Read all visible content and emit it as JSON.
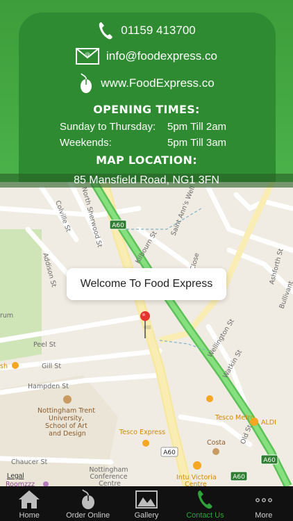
{
  "contact": {
    "phone": "01159 413700",
    "email": "info@foodexpress.co",
    "website": "www.FoodExpress.co"
  },
  "opening_times": {
    "heading": "OPENING TIMES:",
    "rows": [
      {
        "days": "Sunday to Thursday:",
        "hours": "5pm Till  2am"
      },
      {
        "days": "Weekends:",
        "hours": "5pm Till  3am"
      }
    ]
  },
  "map_location": {
    "heading": "MAP LOCATION:",
    "address": "85 Mansfield Road, NG1 3FN"
  },
  "map": {
    "callout": "Welcome To Food Express",
    "legal": "Legal",
    "streets": [
      "Colville St",
      "North Sherwood St",
      "Addison St",
      "Kilbourn St",
      "Saint Ann's Well",
      "Close",
      "Ashforth St",
      "Bullivant",
      "Peel St",
      "Gill St",
      "Hampden St",
      "Wellington St",
      "Watkin St",
      "Chaucer St",
      "Old St",
      "rum"
    ],
    "road_badges": [
      "A60",
      "A60",
      "A60",
      "A60"
    ],
    "pois": [
      "Nottingham Trent University, School of Art and Design",
      "Tesco Express",
      "Tesco Metro",
      "ALDI",
      "Costa",
      "Intu Victoria Centre",
      "Nottingham Conference Centre",
      "Roomzzz",
      "sh"
    ]
  },
  "tabbar": {
    "items": [
      {
        "label": "Home",
        "icon": "home-icon"
      },
      {
        "label": "Order Online",
        "icon": "mouse-icon"
      },
      {
        "label": "Gallery",
        "icon": "gallery-icon"
      },
      {
        "label": "Contact Us",
        "icon": "phone-icon",
        "active": true
      },
      {
        "label": "More",
        "icon": "more-icon"
      }
    ]
  },
  "colors": {
    "brand_green": "#2f8b31",
    "active_tab": "#2fa33a",
    "highway": "#6fd36a"
  }
}
